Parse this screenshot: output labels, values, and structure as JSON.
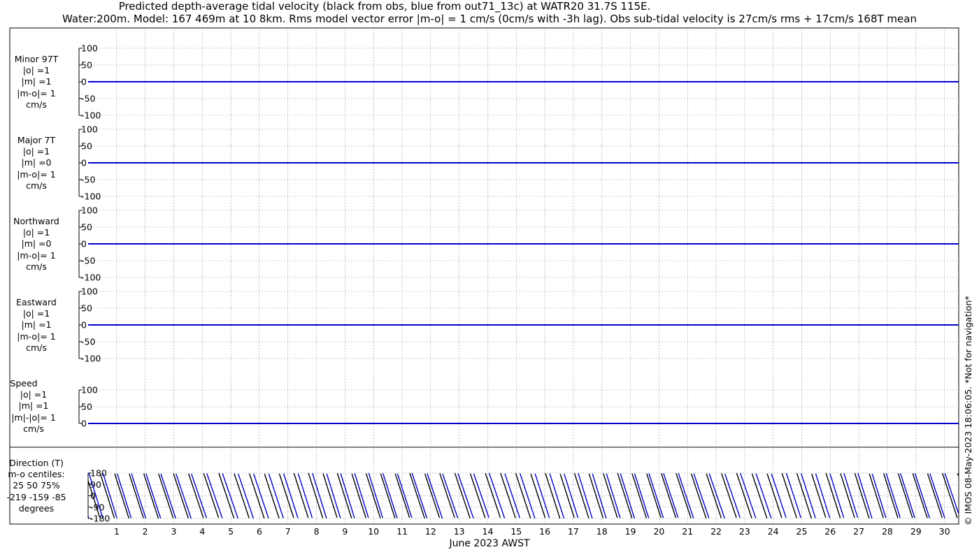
{
  "title_line1": "Predicted depth-average tidal velocity (black from obs, blue from out71_13c) at WATR20 31.7S 115E.",
  "title_line2": "Water:200m. Model: 167 469m at 10 8km. Rms model vector error |m-o| = 1 cm/s (0cm/s with -3h lag). Obs sub-tidal velocity is 27cm/s rms + 17cm/s 168T mean",
  "xlabel": "June 2023 AWST",
  "copyright": "© IMOS 08-May-2023 18:06:05. *Not for navigation*",
  "colors": {
    "obs": "#000000",
    "model": "#0000cc",
    "grid": "#9a9a9a"
  },
  "panels": [
    {
      "label_lines": [
        "Minor 97T",
        "|o| =1",
        "|m| =1",
        "|m-o|= 1",
        "cm/s"
      ]
    },
    {
      "label_lines": [
        "Major 7T",
        "|o| =1",
        "|m| =0",
        "|m-o|= 1",
        "cm/s"
      ]
    },
    {
      "label_lines": [
        "Northward",
        "|o| =1",
        "|m| =0",
        "|m-o|= 1",
        "cm/s"
      ]
    },
    {
      "label_lines": [
        "Eastward",
        "|o| =1",
        "|m| =1",
        "|m-o|= 1",
        "cm/s"
      ]
    },
    {
      "label_lines": [
        "Speed",
        "|o| =1",
        "|m| =1",
        "|m|-|o|= 1",
        "cm/s"
      ]
    },
    {
      "label_lines": [
        "Direction (T)",
        "m-o centiles:",
        "25  50  75%",
        "-219 -159  -85",
        "degrees"
      ]
    }
  ],
  "chart_data": [
    {
      "type": "line",
      "name": "Minor 97T",
      "ylim": [
        -100,
        100
      ],
      "yticks": [
        100,
        50,
        0,
        -50,
        -100
      ],
      "xlim": [
        0,
        30.5
      ],
      "xticks": [
        1,
        2,
        3,
        4,
        5,
        6,
        7,
        8,
        9,
        10,
        11,
        12,
        13,
        14,
        15,
        16,
        17,
        18,
        19,
        20,
        21,
        22,
        23,
        24,
        25,
        26,
        27,
        28,
        29,
        30
      ],
      "series": [
        {
          "name": "obs",
          "values_constant": 0
        },
        {
          "name": "model",
          "values_constant": 0
        }
      ]
    },
    {
      "type": "line",
      "name": "Major 7T",
      "ylim": [
        -100,
        100
      ],
      "yticks": [
        100,
        50,
        0,
        -50,
        -100
      ],
      "series": [
        {
          "name": "obs",
          "values_constant": 0
        },
        {
          "name": "model",
          "values_constant": 0
        }
      ]
    },
    {
      "type": "line",
      "name": "Northward",
      "ylim": [
        -100,
        100
      ],
      "yticks": [
        100,
        50,
        0,
        -50,
        -100
      ],
      "series": [
        {
          "name": "obs",
          "values_constant": 0
        },
        {
          "name": "model",
          "values_constant": 0
        }
      ]
    },
    {
      "type": "line",
      "name": "Eastward",
      "ylim": [
        -100,
        100
      ],
      "yticks": [
        100,
        50,
        0,
        -50,
        -100
      ],
      "series": [
        {
          "name": "obs",
          "values_constant": 0
        },
        {
          "name": "model",
          "values_constant": 0
        }
      ]
    },
    {
      "type": "line",
      "name": "Speed",
      "ylim": [
        0,
        100
      ],
      "yticks": [
        100,
        50,
        0
      ],
      "series": [
        {
          "name": "obs",
          "values_constant": 0
        },
        {
          "name": "model",
          "values_constant": 0
        }
      ]
    },
    {
      "type": "line",
      "name": "Direction (T)",
      "ylim": [
        -180,
        180
      ],
      "yticks": [
        180,
        90,
        0,
        -90,
        -180
      ],
      "note": "wrapping tidal direction, roughly 2 cycles per day",
      "series": [
        {
          "name": "obs"
        },
        {
          "name": "model"
        }
      ]
    }
  ]
}
